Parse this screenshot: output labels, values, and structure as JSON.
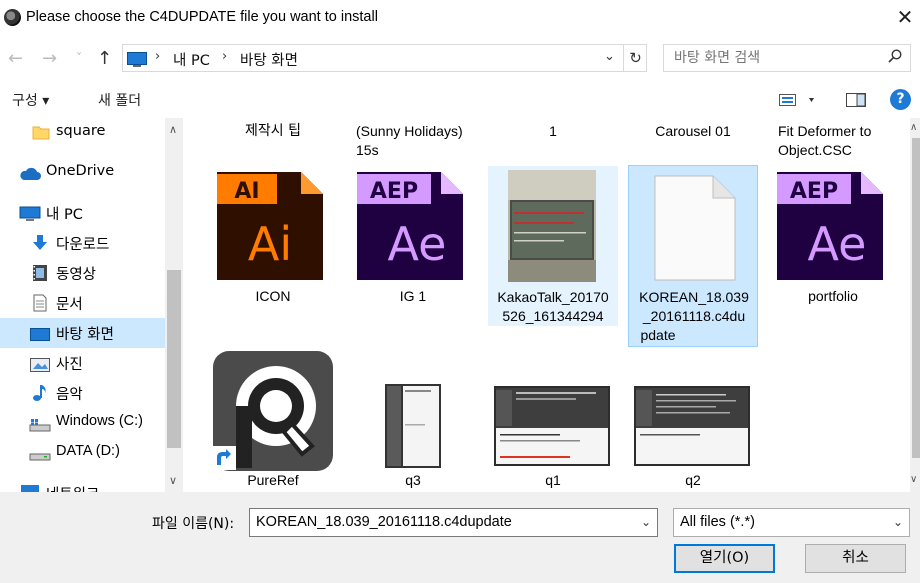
{
  "window": {
    "title": "Please choose the C4DUPDATE file you want to install",
    "close": "✕"
  },
  "nav": {
    "back": "←",
    "forward": "→",
    "recent": "˅",
    "up": "↑",
    "breadcrumb": [
      "내 PC",
      "바탕 화면"
    ],
    "search_placeholder": "바탕 화면 검색"
  },
  "toolbar": {
    "organize": "구성 ▾",
    "new_folder": "새 폴더",
    "help": "?"
  },
  "sidebar": {
    "items": [
      {
        "label": "square",
        "icon": "folder-icon"
      },
      {
        "label": "OneDrive",
        "icon": "cloud-icon"
      },
      {
        "label": "내 PC",
        "icon": "computer-icon"
      },
      {
        "label": "다운로드",
        "icon": "download-icon"
      },
      {
        "label": "동영상",
        "icon": "video-icon"
      },
      {
        "label": "문서",
        "icon": "document-icon"
      },
      {
        "label": "바탕 화면",
        "icon": "desktop-icon",
        "selected": true
      },
      {
        "label": "사진",
        "icon": "pictures-icon"
      },
      {
        "label": "음악",
        "icon": "music-icon"
      },
      {
        "label": "Windows (C:)",
        "icon": "drive-icon"
      },
      {
        "label": "DATA (D:)",
        "icon": "drive-icon"
      },
      {
        "label": "네트워크",
        "icon": "network-icon"
      }
    ]
  },
  "files": {
    "top_row": [
      "제작시 팁",
      "(Sunny Holidays)\n15s",
      "1",
      "Carousel 01",
      "Fit Deformer to\nObject.CSC"
    ],
    "row1": [
      {
        "name": "ICON",
        "icon": "illustrator-file-icon",
        "badge": "AI",
        "big": "Ai"
      },
      {
        "name": "IG 1",
        "icon": "after-effects-file-icon",
        "badge": "AEP",
        "big": "Ae"
      },
      {
        "name": "KakaoTalk_20170526_161344294",
        "icon": "photo-thumbnail",
        "line1": "KakaoTalk_20170",
        "line2": "526_161344294"
      },
      {
        "name": "KOREAN_18.039_20161118.c4dupdate",
        "icon": "blank-file-icon",
        "line1": "KOREAN_18.039",
        "line2": "_20161118.c4du",
        "line3": "pdate"
      },
      {
        "name": "portfolio",
        "icon": "after-effects-file-icon",
        "badge": "AEP",
        "big": "Ae"
      }
    ],
    "row2": [
      {
        "name": "PureRef",
        "icon": "pureref-app-icon"
      },
      {
        "name": "q3",
        "icon": "screenshot-thumbnail"
      },
      {
        "name": "q1",
        "icon": "screenshot-thumbnail"
      },
      {
        "name": "q2",
        "icon": "screenshot-thumbnail"
      }
    ]
  },
  "footer": {
    "filename_label": "파일 이름(N):",
    "filename_value": "KOREAN_18.039_20161118.c4dupdate",
    "filetype_value": "All files (*.*)",
    "open_button": "열기(O)",
    "cancel_button": "취소"
  },
  "colors": {
    "ai_bg": "#2e0f00",
    "ai_accent": "#ff7c00",
    "ae_bg": "#1f0040",
    "ae_accent": "#d49aff",
    "selection": "#cce8ff",
    "accent": "#0078d7"
  }
}
